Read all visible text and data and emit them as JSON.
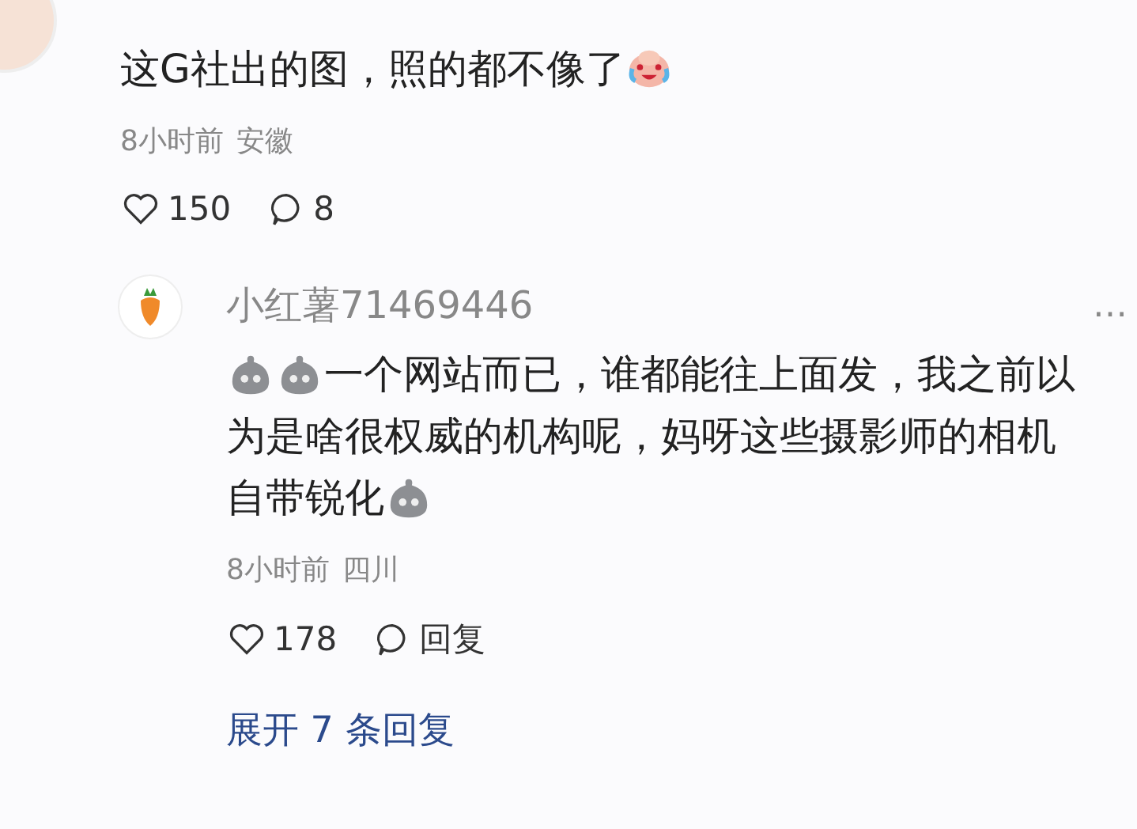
{
  "comments": [
    {
      "content": [
        {
          "kind": "text",
          "text": "这G社出的图，照的都不像了"
        },
        {
          "kind": "emoji"
        }
      ],
      "time": "8小时前",
      "location": "安徽",
      "likes": "150",
      "reply_label": "8"
    },
    {
      "username": "小红薯71469446",
      "more": "…",
      "content_lines": [
        [
          {
            "kind": "emoji"
          },
          {
            "kind": "emoji"
          },
          {
            "kind": "text",
            "text": "一个网站而已，谁都能往上面发，我之前以"
          }
        ],
        [
          {
            "kind": "text",
            "text": "为是啥很权威的机构呢，妈呀这些摄影师的相机"
          }
        ],
        [
          {
            "kind": "text",
            "text": "自带锐化"
          },
          {
            "kind": "emoji"
          }
        ]
      ],
      "time": "8小时前",
      "location": "四川",
      "likes": "178",
      "reply_label": "回复"
    }
  ],
  "expand_replies": "展开 7 条回复"
}
